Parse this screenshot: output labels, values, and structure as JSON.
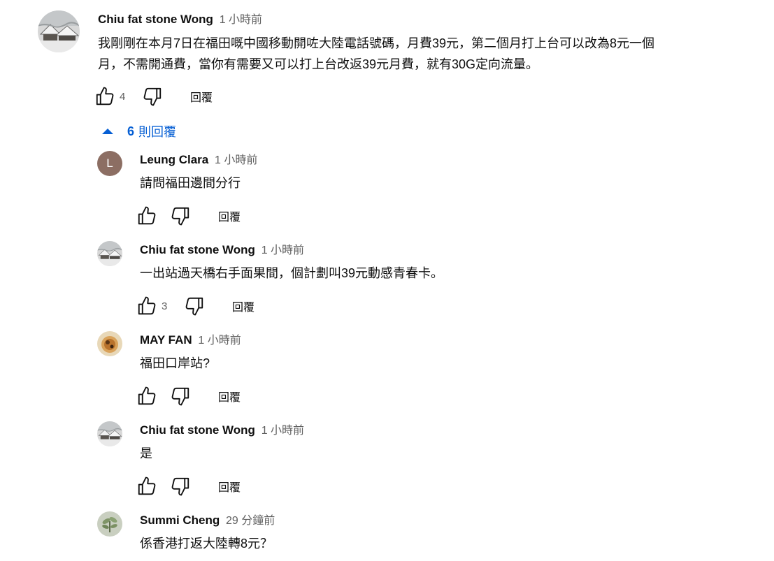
{
  "comments": [
    {
      "author": "Chiu fat stone Wong",
      "time": "1 小時前",
      "text": "我剛剛在本月7日在福田嘅中國移動開咗大陸電話號碼，月費39元，第二個月打上台可以改為8元一個\n月，不需開通費，當你有需要又可以打上台改返39元月費，就有30G定向流量。",
      "likes": "4",
      "reply_label": "回覆",
      "avatar": "snow-village-photo"
    }
  ],
  "replies_toggle": {
    "count": "6",
    "label": "則回覆",
    "icon": "caret-up-icon"
  },
  "replies": [
    {
      "author": "Leung Clara",
      "time": "1 小時前",
      "text": "請問福田邊間分行",
      "likes": "",
      "reply_label": "回覆",
      "avatar_letter": "L",
      "avatar_color": "#8c6e63"
    },
    {
      "author": "Chiu fat stone Wong",
      "time": "1 小時前",
      "text": "一出站過天橋右手面果間，個計劃叫39元動感青春卡。",
      "likes": "3",
      "reply_label": "回覆",
      "avatar": "snow-village-photo"
    },
    {
      "author": "MAY FAN",
      "time": "1 小時前",
      "text": "福田口岸站?",
      "likes": "",
      "reply_label": "回覆",
      "avatar": "pastry-photo"
    },
    {
      "author": "Chiu fat stone Wong",
      "time": "1 小時前",
      "text": "是",
      "likes": "",
      "reply_label": "回覆",
      "avatar": "snow-village-photo"
    },
    {
      "author": "Summi Cheng",
      "time": "29 分鐘前",
      "text": "係香港打返大陸轉8元？",
      "likes": "",
      "reply_label": "",
      "avatar": "plant-photo"
    }
  ],
  "colors": {
    "link_blue": "#065fd4",
    "secondary_text": "#606060",
    "primary_text": "#0f0f0f"
  },
  "icons": [
    "thumbs-up-icon",
    "thumbs-down-icon"
  ]
}
